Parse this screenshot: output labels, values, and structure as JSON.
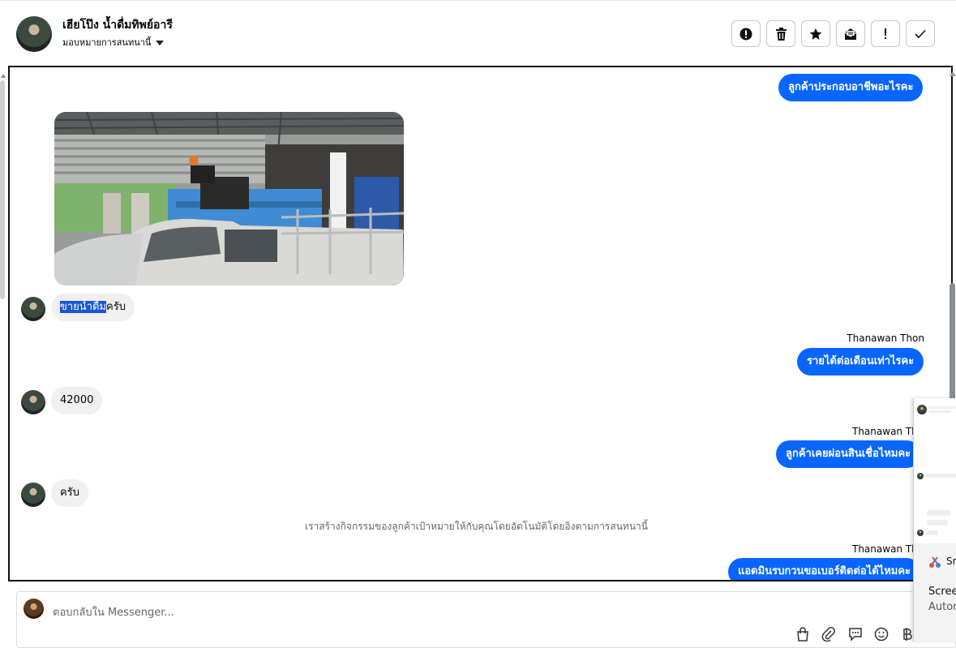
{
  "header": {
    "contact_name": "เฮียโป๊ง น้ำดื่มทิพย์อารี",
    "assign_label": "มอบหมายการสนทนานี้"
  },
  "toolbar": [
    {
      "name": "report-button",
      "icon": "exclamation-circle-icon"
    },
    {
      "name": "delete-button",
      "icon": "trash-icon"
    },
    {
      "name": "star-button",
      "icon": "star-icon"
    },
    {
      "name": "mark-unread-button",
      "icon": "envelope-open-icon"
    },
    {
      "name": "important-button",
      "icon": "exclamation-icon"
    },
    {
      "name": "done-button",
      "icon": "check-icon"
    }
  ],
  "messages": {
    "out_1": "ลูกค้าประกอบอาชีพอะไรคะ",
    "in_1_highlight": "ขายน้ำดื่ม",
    "in_1_rest": "ครับ",
    "sender_2": "Thanawan Thon",
    "out_2": "รายได้ต่อเดือนเท่าไรคะ",
    "in_2": "42000",
    "sender_3": "Thanawan Thon",
    "out_3": "ลูกค้าเคยผ่อนสินเชื่อไหมคะ",
    "in_3": "ครับ",
    "system_note": "เราสร้างกิจกรรมของลูกค้าเป้าหมายให้กับคุณโดยอัตโนมัติโดยอิงตามการสนทนานี้",
    "sender_4": "Thanawan Thon",
    "out_4": "แอดมินรบกวนขอเบอร์ติดต่อได้ไหมคะ"
  },
  "composer": {
    "placeholder": "ตอบกลับใน Messenger...",
    "icons": [
      "shopping-bag-icon",
      "paperclip-icon",
      "chat-bubble-icon",
      "emoji-icon",
      "baht-icon"
    ]
  },
  "popup": {
    "snip_title": "Sn",
    "snip_heading": "Screen",
    "snip_sub": "Autor"
  },
  "colors": {
    "accent": "#0866ff",
    "incoming_bg": "#f0f0f0",
    "selection": "#1a56d6"
  }
}
